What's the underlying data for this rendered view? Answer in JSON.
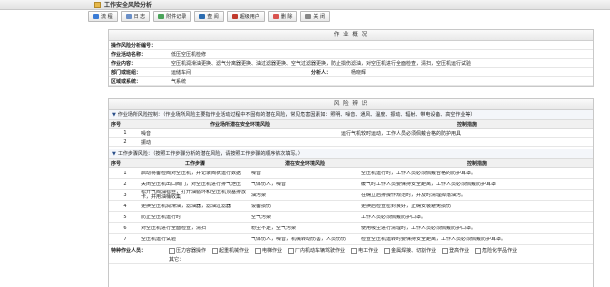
{
  "window": {
    "title": "工作安全风险分析"
  },
  "toolbar": [
    {
      "name": "flow-button",
      "icon": "flow-icon",
      "label": "流 程",
      "color": "#3a7bd5"
    },
    {
      "name": "log-button",
      "icon": "log-icon",
      "label": "日 志",
      "color": "#6a8fc7"
    },
    {
      "name": "gallery-button",
      "icon": "gallery-icon",
      "label": "附件记录",
      "color": "#4aa35a"
    },
    {
      "name": "view-button",
      "icon": "view-icon",
      "label": "查 阅",
      "color": "#2b6cb0"
    },
    {
      "name": "super-user-button",
      "icon": "user-icon",
      "label": "超级用户",
      "color": "#c0392b"
    },
    {
      "name": "delete-button",
      "icon": "delete-icon",
      "label": "删 除",
      "color": "#d9534f"
    },
    {
      "name": "close-button",
      "icon": "close-icon",
      "label": "关 闭",
      "color": "#888888"
    }
  ],
  "overview": {
    "header": "作 业 概 况",
    "rows": [
      {
        "label": "操作风险分析编号：",
        "value": "",
        "label2": "",
        "value2": ""
      },
      {
        "label": "作业活动名称：",
        "value": "低压空压机检修",
        "label2": "",
        "value2": ""
      },
      {
        "label": "作业内容：",
        "value": "空压机润滑油更换、滤气分离器更换、油过滤器更换、空气过滤器更换，防止损伤滤油，对空压机进行全面检查，清扫，空压机运行试验",
        "label2": "",
        "value2": ""
      },
      {
        "label": "部门或班组：",
        "value": "运储车间",
        "label2": "分析人：",
        "value2": "杨晓辉"
      },
      {
        "label": "区域或系统：",
        "value": "气系统",
        "label2": "",
        "value2": ""
      }
    ]
  },
  "risk": {
    "header": "风 险 辨 识",
    "section1": {
      "title": "作业场所风险控制：（作业场所风险主要指作业活动过程中不固有的潜在风险，常见危害因素如：照明、噪音、通风、温度、振动、辐射、带电设备、高空作业等）",
      "cols": [
        "序号",
        "作业场所潜在安全环境风险",
        "控制措施"
      ],
      "rows": [
        {
          "no": "1",
          "risk": "噪音",
          "measure": "运行气机较时运动，工作人员必须佩戴合格的防护用具"
        },
        {
          "no": "2",
          "risk": "振动",
          "measure": ""
        }
      ]
    },
    "section2": {
      "title": "工作步骤风险：（按照工作步骤分析的潜在风险，请按照工作步骤的顺序依次填写。）",
      "cols": [
        "序号",
        "工作步骤",
        "潜在安全环境风险",
        "控制措施"
      ],
      "rows": [
        {
          "no": "1",
          "step": "启动将备检阀对空压机，并记录阀状运行数据",
          "risk": "噪音",
          "measure": "空压机运行时，工作人员必须佩戴合格的防护耳罩。"
        },
        {
          "no": "2",
          "step": "关闭空压机出口阀门，对空压机进行排气泄压",
          "risk": "气体伤人，噪音",
          "measure": "缓气时工作人员要保持安全距离，工作人员必须佩戴防护耳罩"
        },
        {
          "no": "3",
          "step": "松开气阀油标丝，打开油循环和空压机顶塞排放卡，并用油桶收集",
          "risk": "油污染",
          "measure": "在确立后排操作规范时，并及时清理掉落油污。"
        },
        {
          "no": "4",
          "step": "更换空压机润滑油，滤油器，滤油过滤器",
          "risk": "设备损伤",
          "measure": "更换后检查密封良好，正确安装避免损伤"
        },
        {
          "no": "5",
          "step": "防止空压机运行时",
          "risk": "空气污染",
          "measure": "工作人员必须佩戴防护口罩。"
        },
        {
          "no": "6",
          "step": "对空压机进行全面检查，清扫",
          "risk": "粉尘不足，空气污染",
          "measure": "使用吸尘进行清理时，工作人员必须佩戴防护口罩。"
        },
        {
          "no": "7",
          "step": "空压机运行试验",
          "risk": "气体伤人，噪音，机械转动伤害，人员伤伤",
          "measure": "检查空压机运转时要保持安全距离，工作人员必须佩戴防护耳罩。"
        }
      ]
    },
    "special": {
      "label": "特种作业人员：",
      "options": [
        "压力容器操作",
        "起重机械作业",
        "电梯作业",
        "厂内机动车辆驾驶作业",
        "电工作业",
        "金属焊接、切割作业",
        "登高作业",
        "危险化学品作业"
      ],
      "extra": "其它："
    }
  }
}
